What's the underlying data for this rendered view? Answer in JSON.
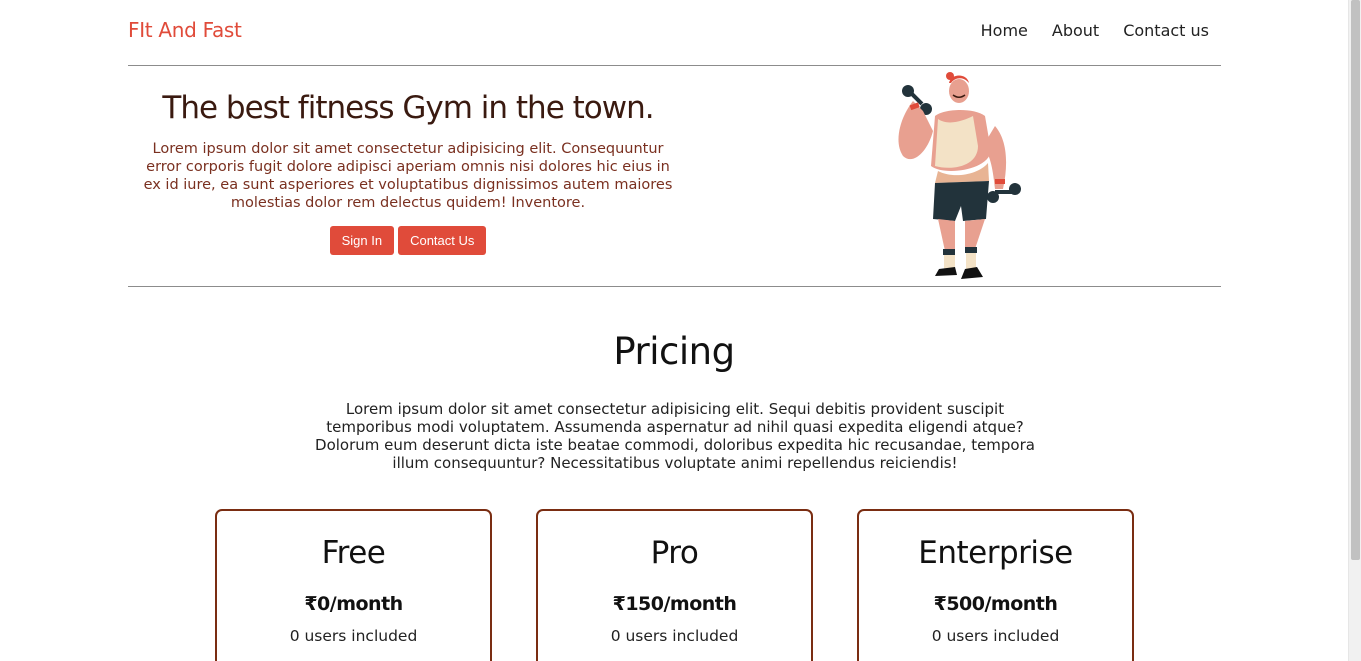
{
  "navbar": {
    "brand": "FIt And Fast",
    "links": [
      "Home",
      "About",
      "Contact us"
    ]
  },
  "hero": {
    "title": "The best fitness Gym in the town.",
    "text": "Lorem ipsum dolor sit amet consectetur adipisicing elit. Consequuntur error corporis fugit dolore adipisci aperiam omnis nisi dolores hic eius in ex id iure, ea sunt asperiores et voluptatibus dignissimos autem maiores molestias dolor rem delectus quidem! Inventore.",
    "buttons": {
      "sign_in": "Sign In",
      "contact": "Contact Us"
    }
  },
  "pricing": {
    "title": "Pricing",
    "text": "Lorem ipsum dolor sit amet consectetur adipisicing elit. Sequi debitis provident suscipit temporibus modi voluptatem. Assumenda aspernatur ad nihil quasi expedita eligendi atque? Dolorum eum deserunt dicta iste beatae commodi, doloribus expedita hic recusandae, tempora illum consequuntur? Necessitatibus voluptate animi repellendus reiciendis!",
    "plans": [
      {
        "name": "Free",
        "price": "₹0/month",
        "users": "0 users included"
      },
      {
        "name": "Pro",
        "price": "₹150/month",
        "users": "0 users included"
      },
      {
        "name": "Enterprise",
        "price": "₹500/month",
        "users": "0 users included"
      }
    ]
  },
  "colors": {
    "accent": "#e04b3a",
    "card_border": "#7a2d12",
    "hero_text": "#7a3020"
  }
}
